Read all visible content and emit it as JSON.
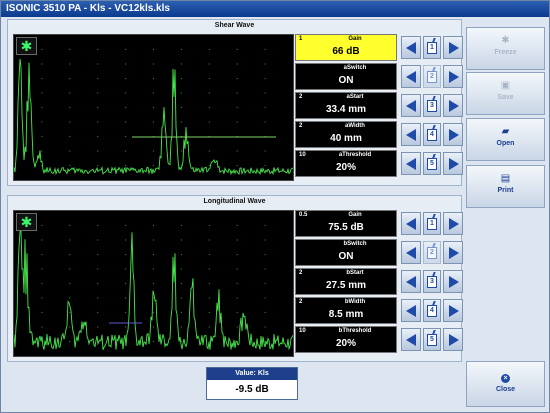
{
  "window": {
    "title": "ISONIC 3510 PA - Kls - VC12kls.kls"
  },
  "panels": [
    {
      "title": "Shear Wave",
      "params": [
        {
          "step": "1",
          "name": "Gain",
          "value": "66 dB",
          "active": true,
          "num": "1"
        },
        {
          "step": "",
          "name": "aSwitch",
          "value": "ON",
          "active": false,
          "num": "2"
        },
        {
          "step": "2",
          "name": "aStart",
          "value": "33.4 mm",
          "active": false,
          "num": "3"
        },
        {
          "step": "2",
          "name": "aWidth",
          "value": "40 mm",
          "active": false,
          "num": "4"
        },
        {
          "step": "10",
          "name": "aThreshold",
          "value": "20%",
          "active": false,
          "num": "5"
        }
      ]
    },
    {
      "title": "Longitudinal Wave",
      "params": [
        {
          "step": "0.5",
          "name": "Gain",
          "value": "75.5 dB",
          "active": false,
          "num": "1"
        },
        {
          "step": "",
          "name": "bSwitch",
          "value": "ON",
          "active": false,
          "num": "2"
        },
        {
          "step": "2",
          "name": "bStart",
          "value": "27.5 mm",
          "active": false,
          "num": "3"
        },
        {
          "step": "2",
          "name": "bWidth",
          "value": "8.5 mm",
          "active": false,
          "num": "4"
        },
        {
          "step": "10",
          "name": "bThreshold",
          "value": "20%",
          "active": false,
          "num": "5"
        }
      ]
    }
  ],
  "sidebar": {
    "freeze": {
      "label": "Freeze",
      "icon": "snowflake-icon"
    },
    "save": {
      "label": "Save",
      "icon": "disk-icon"
    },
    "open": {
      "label": "Open",
      "icon": "folder-icon"
    },
    "print": {
      "label": "Print",
      "icon": "printer-icon"
    },
    "close": {
      "label": "Close",
      "icon": "close-icon"
    }
  },
  "value_box": {
    "label": "Value: Kls",
    "value": "-9.5 dB"
  },
  "colors": {
    "trace": "#46e84a",
    "grid": "#2a8a2a",
    "gate_shear": "#7fd36a",
    "gate_long": "#5b5bd8",
    "active_param": "#ffff2e",
    "titlebar": "#0a3a8e"
  }
}
